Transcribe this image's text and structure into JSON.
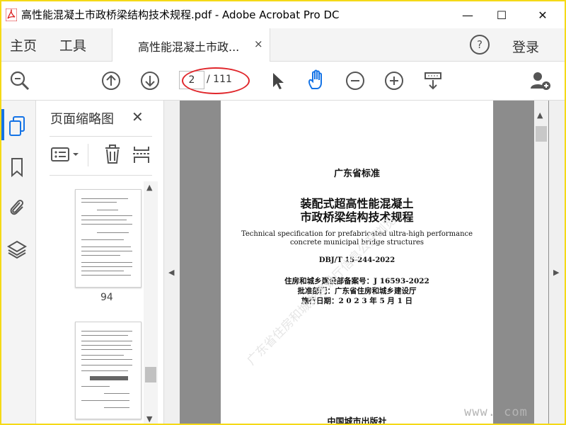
{
  "window": {
    "title": "高性能混凝土市政桥梁结构技术规程.pdf - Adobe Acrobat Pro DC",
    "minimize_glyph": "—",
    "maximize_glyph": "☐",
    "close_glyph": "✕"
  },
  "nav": {
    "home": "主页",
    "tools": "工具",
    "doc_tab": "高性能混凝土市政...",
    "doc_tab_close": "×",
    "help_glyph": "?",
    "login": "登录"
  },
  "toolbar": {
    "page_current": "2",
    "page_total": "/ 111"
  },
  "panel": {
    "title": "页面缩略图",
    "close": "✕",
    "thumb_page_label": "94"
  },
  "page": {
    "header": "广东省标准",
    "title_line1": "装配式超高性能混凝土",
    "title_line2": "市政桥梁结构技术规程",
    "en_line1": "Technical specification for prefabricated ultra-high performance",
    "en_line2": "concrete municipal bridge structures",
    "code": "DBJ/T 15-244-2022",
    "record": "住房和城乡建设部备案号：J 16593-2022",
    "approver": "批准部门：广东省住房和城乡建设厅",
    "date": "施行日期：2 0 2 3 年 5 月 1 日",
    "publisher": "中国城市出版社",
    "watermark_diag": "广东省住房和城乡建设厅信息公开浏览",
    "watermark_url": "www.          com"
  },
  "colors": {
    "accent": "#1473e6",
    "highlight": "#e0262b",
    "frame": "#f5d916"
  }
}
